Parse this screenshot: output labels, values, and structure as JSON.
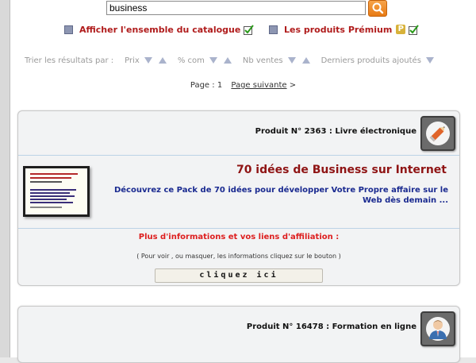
{
  "search": {
    "value": "business"
  },
  "filters": {
    "all_catalog_label": "Afficher l'ensemble du catalogue",
    "premium_label": "Les produits Prémium"
  },
  "sort": {
    "label": "Trier les résultats par :",
    "options": [
      "Prix",
      "% com",
      "Nb ventes",
      "Derniers produits ajoutés"
    ]
  },
  "pagination": {
    "page_label": "Page :",
    "current": "1",
    "next_label": "Page suivante",
    "next_arrow": ">"
  },
  "products": [
    {
      "header": "Produit N° 2363 : Livre électronique",
      "icon": "pencil-icon",
      "title": "70 idées de Business sur Internet",
      "description": "Découvrez ce Pack de 70 idées pour développer Votre Propre affaire sur le Web dès demain ...",
      "more_title": "Plus d'informations et vos liens d'affiliation :",
      "more_note": "( Pour voir , ou masquer, les informations cliquez sur le bouton )",
      "button_label": "cliquez ici"
    },
    {
      "header": "Produit N° 16478 : Formation en ligne",
      "icon": "person-icon"
    }
  ],
  "colors": {
    "accent_red": "#b01c1c",
    "title_red": "#8f1414",
    "desc_blue": "#1a2a90",
    "search_orange": "#f28c28"
  }
}
